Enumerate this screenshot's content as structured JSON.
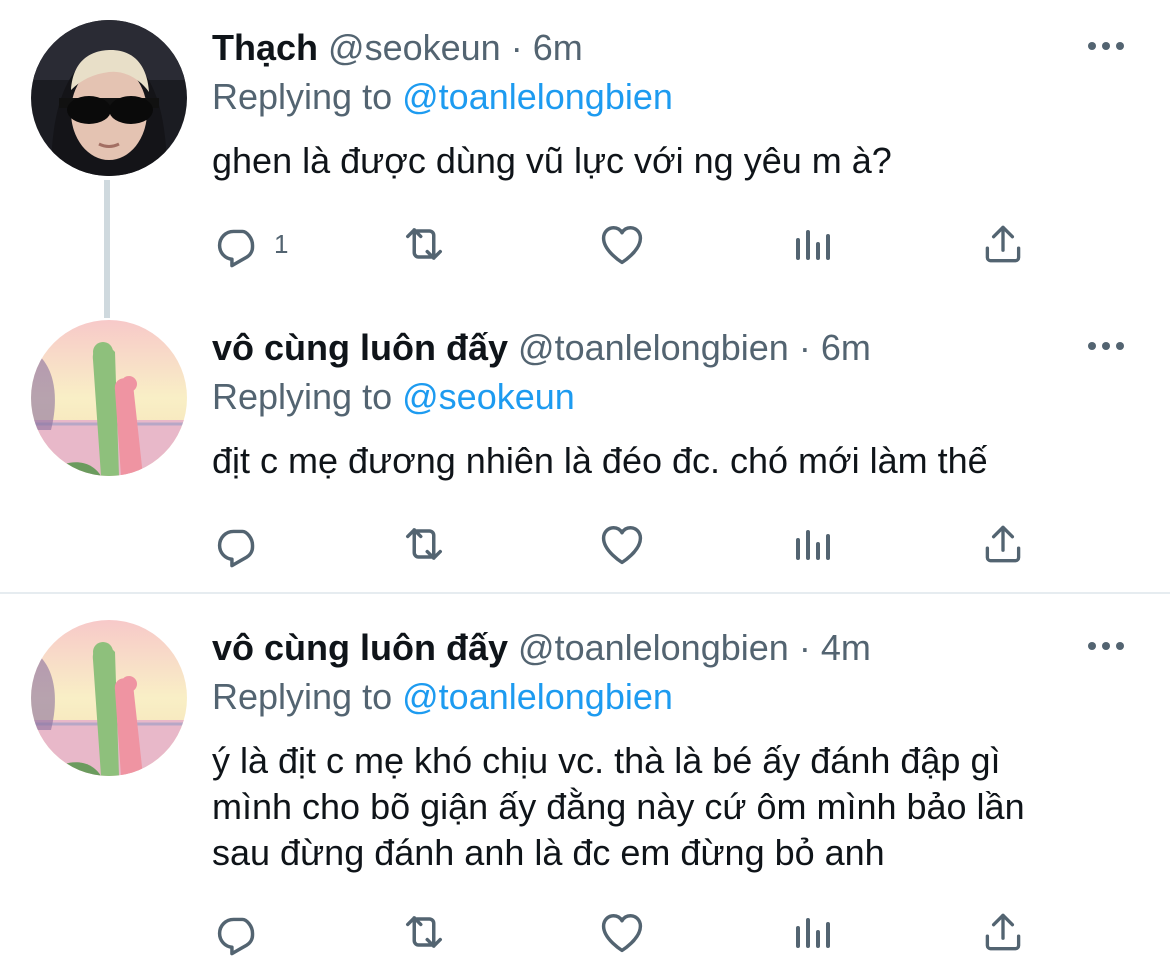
{
  "tweets": [
    {
      "name": "Thạch",
      "handle": "@seokeun",
      "dot": "·",
      "time": "6m",
      "replying_label": "Replying to",
      "replying_to": "@toanlelongbien",
      "text": "ghen là được dùng vũ lực với ng yêu m à?",
      "reply_count": "1"
    },
    {
      "name": "vô cùng luôn đấy",
      "handle": "@toanlelongbien",
      "dot": "·",
      "time": "6m",
      "replying_label": "Replying to",
      "replying_to": "@seokeun",
      "text": "địt c mẹ đương nhiên là đéo đc. chó mới làm thế",
      "reply_count": ""
    },
    {
      "name": "vô cùng luôn đấy",
      "handle": "@toanlelongbien",
      "dot": "·",
      "time": "4m",
      "replying_label": "Replying to",
      "replying_to": "@toanlelongbien",
      "text_lines": [
        "ý là địt c mẹ khó chịu vc. thà là bé ấy đánh đập gì",
        "mình cho bõ giận ấy đằng này cứ ôm mình bảo lần",
        "sau đừng đánh anh là đc em đừng bỏ anh"
      ],
      "reply_count": ""
    }
  ],
  "icons": {
    "reply": "reply-icon",
    "retweet": "retweet-icon",
    "like": "heart-icon",
    "analytics": "analytics-icon",
    "share": "share-icon",
    "more": "more-icon"
  },
  "colors": {
    "text": "#0f1419",
    "secondary": "#536471",
    "link": "#1d9bf0",
    "thread_line": "#cfd9de"
  }
}
